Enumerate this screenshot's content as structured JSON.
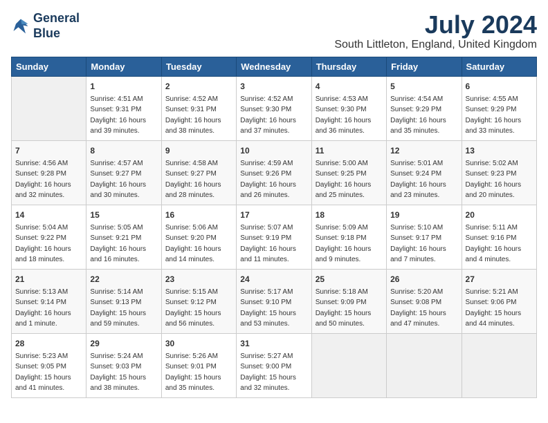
{
  "logo": {
    "line1": "General",
    "line2": "Blue"
  },
  "header": {
    "month": "July 2024",
    "location": "South Littleton, England, United Kingdom"
  },
  "weekdays": [
    "Sunday",
    "Monday",
    "Tuesday",
    "Wednesday",
    "Thursday",
    "Friday",
    "Saturday"
  ],
  "weeks": [
    [
      {
        "date": "",
        "info": ""
      },
      {
        "date": "1",
        "info": "Sunrise: 4:51 AM\nSunset: 9:31 PM\nDaylight: 16 hours\nand 39 minutes."
      },
      {
        "date": "2",
        "info": "Sunrise: 4:52 AM\nSunset: 9:31 PM\nDaylight: 16 hours\nand 38 minutes."
      },
      {
        "date": "3",
        "info": "Sunrise: 4:52 AM\nSunset: 9:30 PM\nDaylight: 16 hours\nand 37 minutes."
      },
      {
        "date": "4",
        "info": "Sunrise: 4:53 AM\nSunset: 9:30 PM\nDaylight: 16 hours\nand 36 minutes."
      },
      {
        "date": "5",
        "info": "Sunrise: 4:54 AM\nSunset: 9:29 PM\nDaylight: 16 hours\nand 35 minutes."
      },
      {
        "date": "6",
        "info": "Sunrise: 4:55 AM\nSunset: 9:29 PM\nDaylight: 16 hours\nand 33 minutes."
      }
    ],
    [
      {
        "date": "7",
        "info": "Sunrise: 4:56 AM\nSunset: 9:28 PM\nDaylight: 16 hours\nand 32 minutes."
      },
      {
        "date": "8",
        "info": "Sunrise: 4:57 AM\nSunset: 9:27 PM\nDaylight: 16 hours\nand 30 minutes."
      },
      {
        "date": "9",
        "info": "Sunrise: 4:58 AM\nSunset: 9:27 PM\nDaylight: 16 hours\nand 28 minutes."
      },
      {
        "date": "10",
        "info": "Sunrise: 4:59 AM\nSunset: 9:26 PM\nDaylight: 16 hours\nand 26 minutes."
      },
      {
        "date": "11",
        "info": "Sunrise: 5:00 AM\nSunset: 9:25 PM\nDaylight: 16 hours\nand 25 minutes."
      },
      {
        "date": "12",
        "info": "Sunrise: 5:01 AM\nSunset: 9:24 PM\nDaylight: 16 hours\nand 23 minutes."
      },
      {
        "date": "13",
        "info": "Sunrise: 5:02 AM\nSunset: 9:23 PM\nDaylight: 16 hours\nand 20 minutes."
      }
    ],
    [
      {
        "date": "14",
        "info": "Sunrise: 5:04 AM\nSunset: 9:22 PM\nDaylight: 16 hours\nand 18 minutes."
      },
      {
        "date": "15",
        "info": "Sunrise: 5:05 AM\nSunset: 9:21 PM\nDaylight: 16 hours\nand 16 minutes."
      },
      {
        "date": "16",
        "info": "Sunrise: 5:06 AM\nSunset: 9:20 PM\nDaylight: 16 hours\nand 14 minutes."
      },
      {
        "date": "17",
        "info": "Sunrise: 5:07 AM\nSunset: 9:19 PM\nDaylight: 16 hours\nand 11 minutes."
      },
      {
        "date": "18",
        "info": "Sunrise: 5:09 AM\nSunset: 9:18 PM\nDaylight: 16 hours\nand 9 minutes."
      },
      {
        "date": "19",
        "info": "Sunrise: 5:10 AM\nSunset: 9:17 PM\nDaylight: 16 hours\nand 7 minutes."
      },
      {
        "date": "20",
        "info": "Sunrise: 5:11 AM\nSunset: 9:16 PM\nDaylight: 16 hours\nand 4 minutes."
      }
    ],
    [
      {
        "date": "21",
        "info": "Sunrise: 5:13 AM\nSunset: 9:14 PM\nDaylight: 16 hours\nand 1 minute."
      },
      {
        "date": "22",
        "info": "Sunrise: 5:14 AM\nSunset: 9:13 PM\nDaylight: 15 hours\nand 59 minutes."
      },
      {
        "date": "23",
        "info": "Sunrise: 5:15 AM\nSunset: 9:12 PM\nDaylight: 15 hours\nand 56 minutes."
      },
      {
        "date": "24",
        "info": "Sunrise: 5:17 AM\nSunset: 9:10 PM\nDaylight: 15 hours\nand 53 minutes."
      },
      {
        "date": "25",
        "info": "Sunrise: 5:18 AM\nSunset: 9:09 PM\nDaylight: 15 hours\nand 50 minutes."
      },
      {
        "date": "26",
        "info": "Sunrise: 5:20 AM\nSunset: 9:08 PM\nDaylight: 15 hours\nand 47 minutes."
      },
      {
        "date": "27",
        "info": "Sunrise: 5:21 AM\nSunset: 9:06 PM\nDaylight: 15 hours\nand 44 minutes."
      }
    ],
    [
      {
        "date": "28",
        "info": "Sunrise: 5:23 AM\nSunset: 9:05 PM\nDaylight: 15 hours\nand 41 minutes."
      },
      {
        "date": "29",
        "info": "Sunrise: 5:24 AM\nSunset: 9:03 PM\nDaylight: 15 hours\nand 38 minutes."
      },
      {
        "date": "30",
        "info": "Sunrise: 5:26 AM\nSunset: 9:01 PM\nDaylight: 15 hours\nand 35 minutes."
      },
      {
        "date": "31",
        "info": "Sunrise: 5:27 AM\nSunset: 9:00 PM\nDaylight: 15 hours\nand 32 minutes."
      },
      {
        "date": "",
        "info": ""
      },
      {
        "date": "",
        "info": ""
      },
      {
        "date": "",
        "info": ""
      }
    ]
  ]
}
